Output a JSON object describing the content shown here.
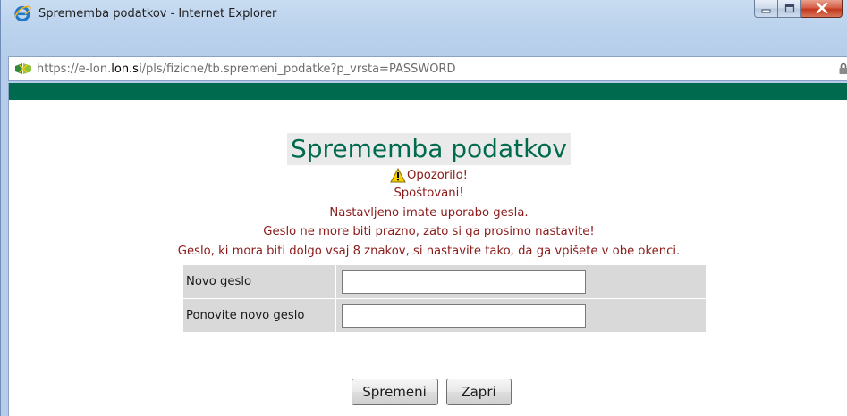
{
  "window": {
    "title": "Sprememba podatkov - Internet Explorer",
    "icon": "internet-explorer-icon",
    "controls": [
      "minimize-icon",
      "maximize-icon",
      "close-icon"
    ]
  },
  "address_bar": {
    "prefix": "https://",
    "host_pre": "e-lon.",
    "host_bold": "lon.si",
    "path": "/pls/fizicne/tb.spremeni_podatke?p_vrsta=PASSWORD",
    "site_icon": "site-favicon",
    "secure_icon": "lock-icon"
  },
  "page": {
    "heading": "Sprememba podatkov",
    "warning_label": "Opozorilo!",
    "greeting": "Spoštovani!",
    "lines": [
      "Nastavljeno imate uporabo gesla.",
      "Geslo ne more biti prazno, zato si ga prosimo nastavite!",
      "Geslo, ki mora biti dolgo vsaj 8 znakov, si nastavite tako, da ga vpišete v obe okenci."
    ],
    "form": {
      "new_password_label": "Novo geslo",
      "new_password_value": "",
      "repeat_password_label": "Ponovite novo geslo",
      "repeat_password_value": ""
    },
    "buttons": {
      "save": "Spremeni",
      "close": "Zapri"
    }
  },
  "colors": {
    "brand_green": "#006a4e",
    "message_red": "#8b1a1a",
    "form_gray": "#d9d9d9"
  }
}
